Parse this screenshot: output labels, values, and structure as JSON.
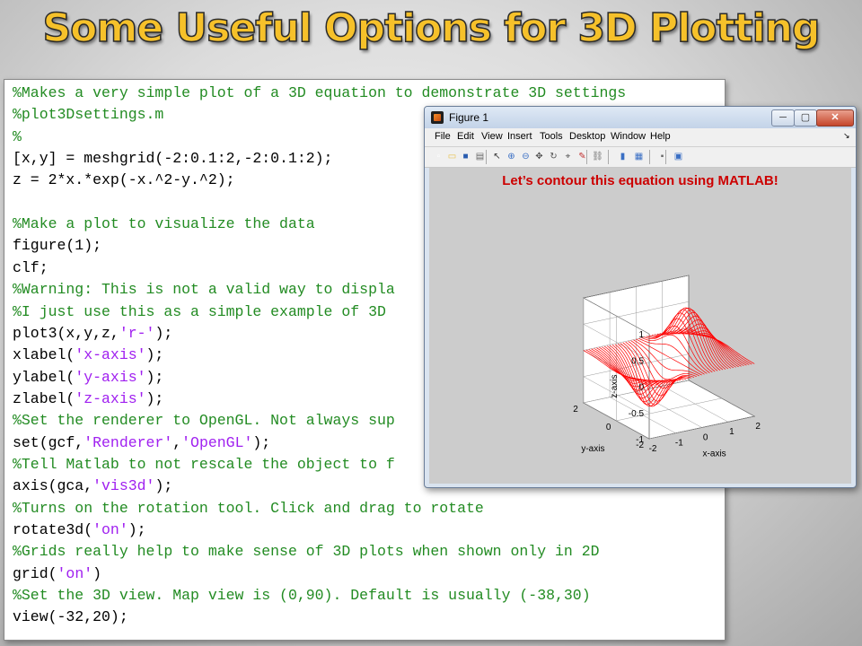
{
  "slide": {
    "title": "Some Useful Options for 3D Plotting",
    "title_color": "#f6c12a"
  },
  "code": {
    "lines": [
      {
        "kind": "comment",
        "text": "%Makes a very simple plot of a 3D equation to demonstrate 3D settings"
      },
      {
        "kind": "comment",
        "text": "%plot3Dsettings.m"
      },
      {
        "kind": "comment",
        "text": "%"
      },
      {
        "kind": "code",
        "text": "[x,y] = meshgrid(-2:0.1:2,-2:0.1:2);"
      },
      {
        "kind": "code",
        "text": "z = 2*x.*exp(-x.^2-y.^2);"
      },
      {
        "kind": "blank",
        "text": ""
      },
      {
        "kind": "comment",
        "text": "%Make a plot to visualize the data"
      },
      {
        "kind": "code",
        "text": "figure(1);"
      },
      {
        "kind": "code",
        "text": "clf;"
      },
      {
        "kind": "comment",
        "text": "%Warning: This is not a valid way to displa"
      },
      {
        "kind": "comment",
        "text": "%I just use this as a simple example of 3D"
      },
      {
        "kind": "code",
        "parts": [
          "plot3(x,y,z,",
          "'r-'",
          ");"
        ]
      },
      {
        "kind": "code",
        "parts": [
          "xlabel(",
          "'x-axis'",
          ");"
        ]
      },
      {
        "kind": "code",
        "parts": [
          "ylabel(",
          "'y-axis'",
          ");"
        ]
      },
      {
        "kind": "code",
        "parts": [
          "zlabel(",
          "'z-axis'",
          ");"
        ]
      },
      {
        "kind": "comment",
        "text": "%Set the renderer to OpenGL. Not always sup"
      },
      {
        "kind": "code",
        "parts": [
          "set(gcf,",
          "'Renderer'",
          ",",
          "'OpenGL'",
          ");"
        ]
      },
      {
        "kind": "comment",
        "text": "%Tell Matlab to not rescale the object to f"
      },
      {
        "kind": "code",
        "parts": [
          "axis(gca,",
          "'vis3d'",
          ");"
        ]
      },
      {
        "kind": "comment",
        "text": "%Turns on the rotation tool. Click and drag to rotate"
      },
      {
        "kind": "code",
        "parts": [
          "rotate3d(",
          "'on'",
          ");"
        ]
      },
      {
        "kind": "comment",
        "text": "%Grids really help to make sense of 3D plots when shown only in 2D"
      },
      {
        "kind": "code",
        "parts": [
          "grid(",
          "'on'",
          ")"
        ]
      },
      {
        "kind": "comment",
        "text": "%Set the 3D view. Map view is (0,90). Default is usually (-38,30)"
      },
      {
        "kind": "code",
        "text": "view(-32,20);"
      }
    ],
    "colors": {
      "comment": "#228b22",
      "string": "#a020f0",
      "code": "#000000"
    }
  },
  "figure_window": {
    "title": "Figure 1",
    "buttons": {
      "minimize": "─",
      "maximize": "▢",
      "close": "✕"
    },
    "menu": [
      "File",
      "Edit",
      "View",
      "Insert",
      "Tools",
      "Desktop",
      "Window",
      "Help"
    ],
    "menu_arrow": "↘",
    "toolbar_icons": [
      "new-figure-icon",
      "open-file-icon",
      "save-icon",
      "print-icon",
      "pointer-icon",
      "zoom-in-icon",
      "zoom-out-icon",
      "pan-icon",
      "rotate-3d-icon",
      "data-cursor-icon",
      "brush-icon",
      "link-icon",
      "colorbar-icon",
      "legend-icon",
      "hide-plot-tools-icon",
      "show-plot-tools-icon"
    ],
    "annotation": "Let’s contour this equation using MATLAB!",
    "annotation_color": "#cc0000"
  },
  "chart_data": {
    "type": "line",
    "function": "z = 2*x.*exp(-x.^2-y.^2)",
    "grid": "x,y in [-2,2] step 0.1",
    "line_color": "#ff0000",
    "view": {
      "azimuth": -32,
      "elevation": 20
    },
    "grid_on": true,
    "xlabel": "x-axis",
    "ylabel": "y-axis",
    "zlabel": "z-axis",
    "xlim": [
      -2,
      2
    ],
    "ylim": [
      -2,
      2
    ],
    "zlim": [
      -1,
      1
    ],
    "xticks": [
      "-2",
      "-1",
      "0",
      "1",
      "2"
    ],
    "yticks": [
      "-2",
      "0",
      "2"
    ],
    "zticks": [
      "-1",
      "-0.5",
      "0",
      "0.5",
      "1"
    ]
  }
}
